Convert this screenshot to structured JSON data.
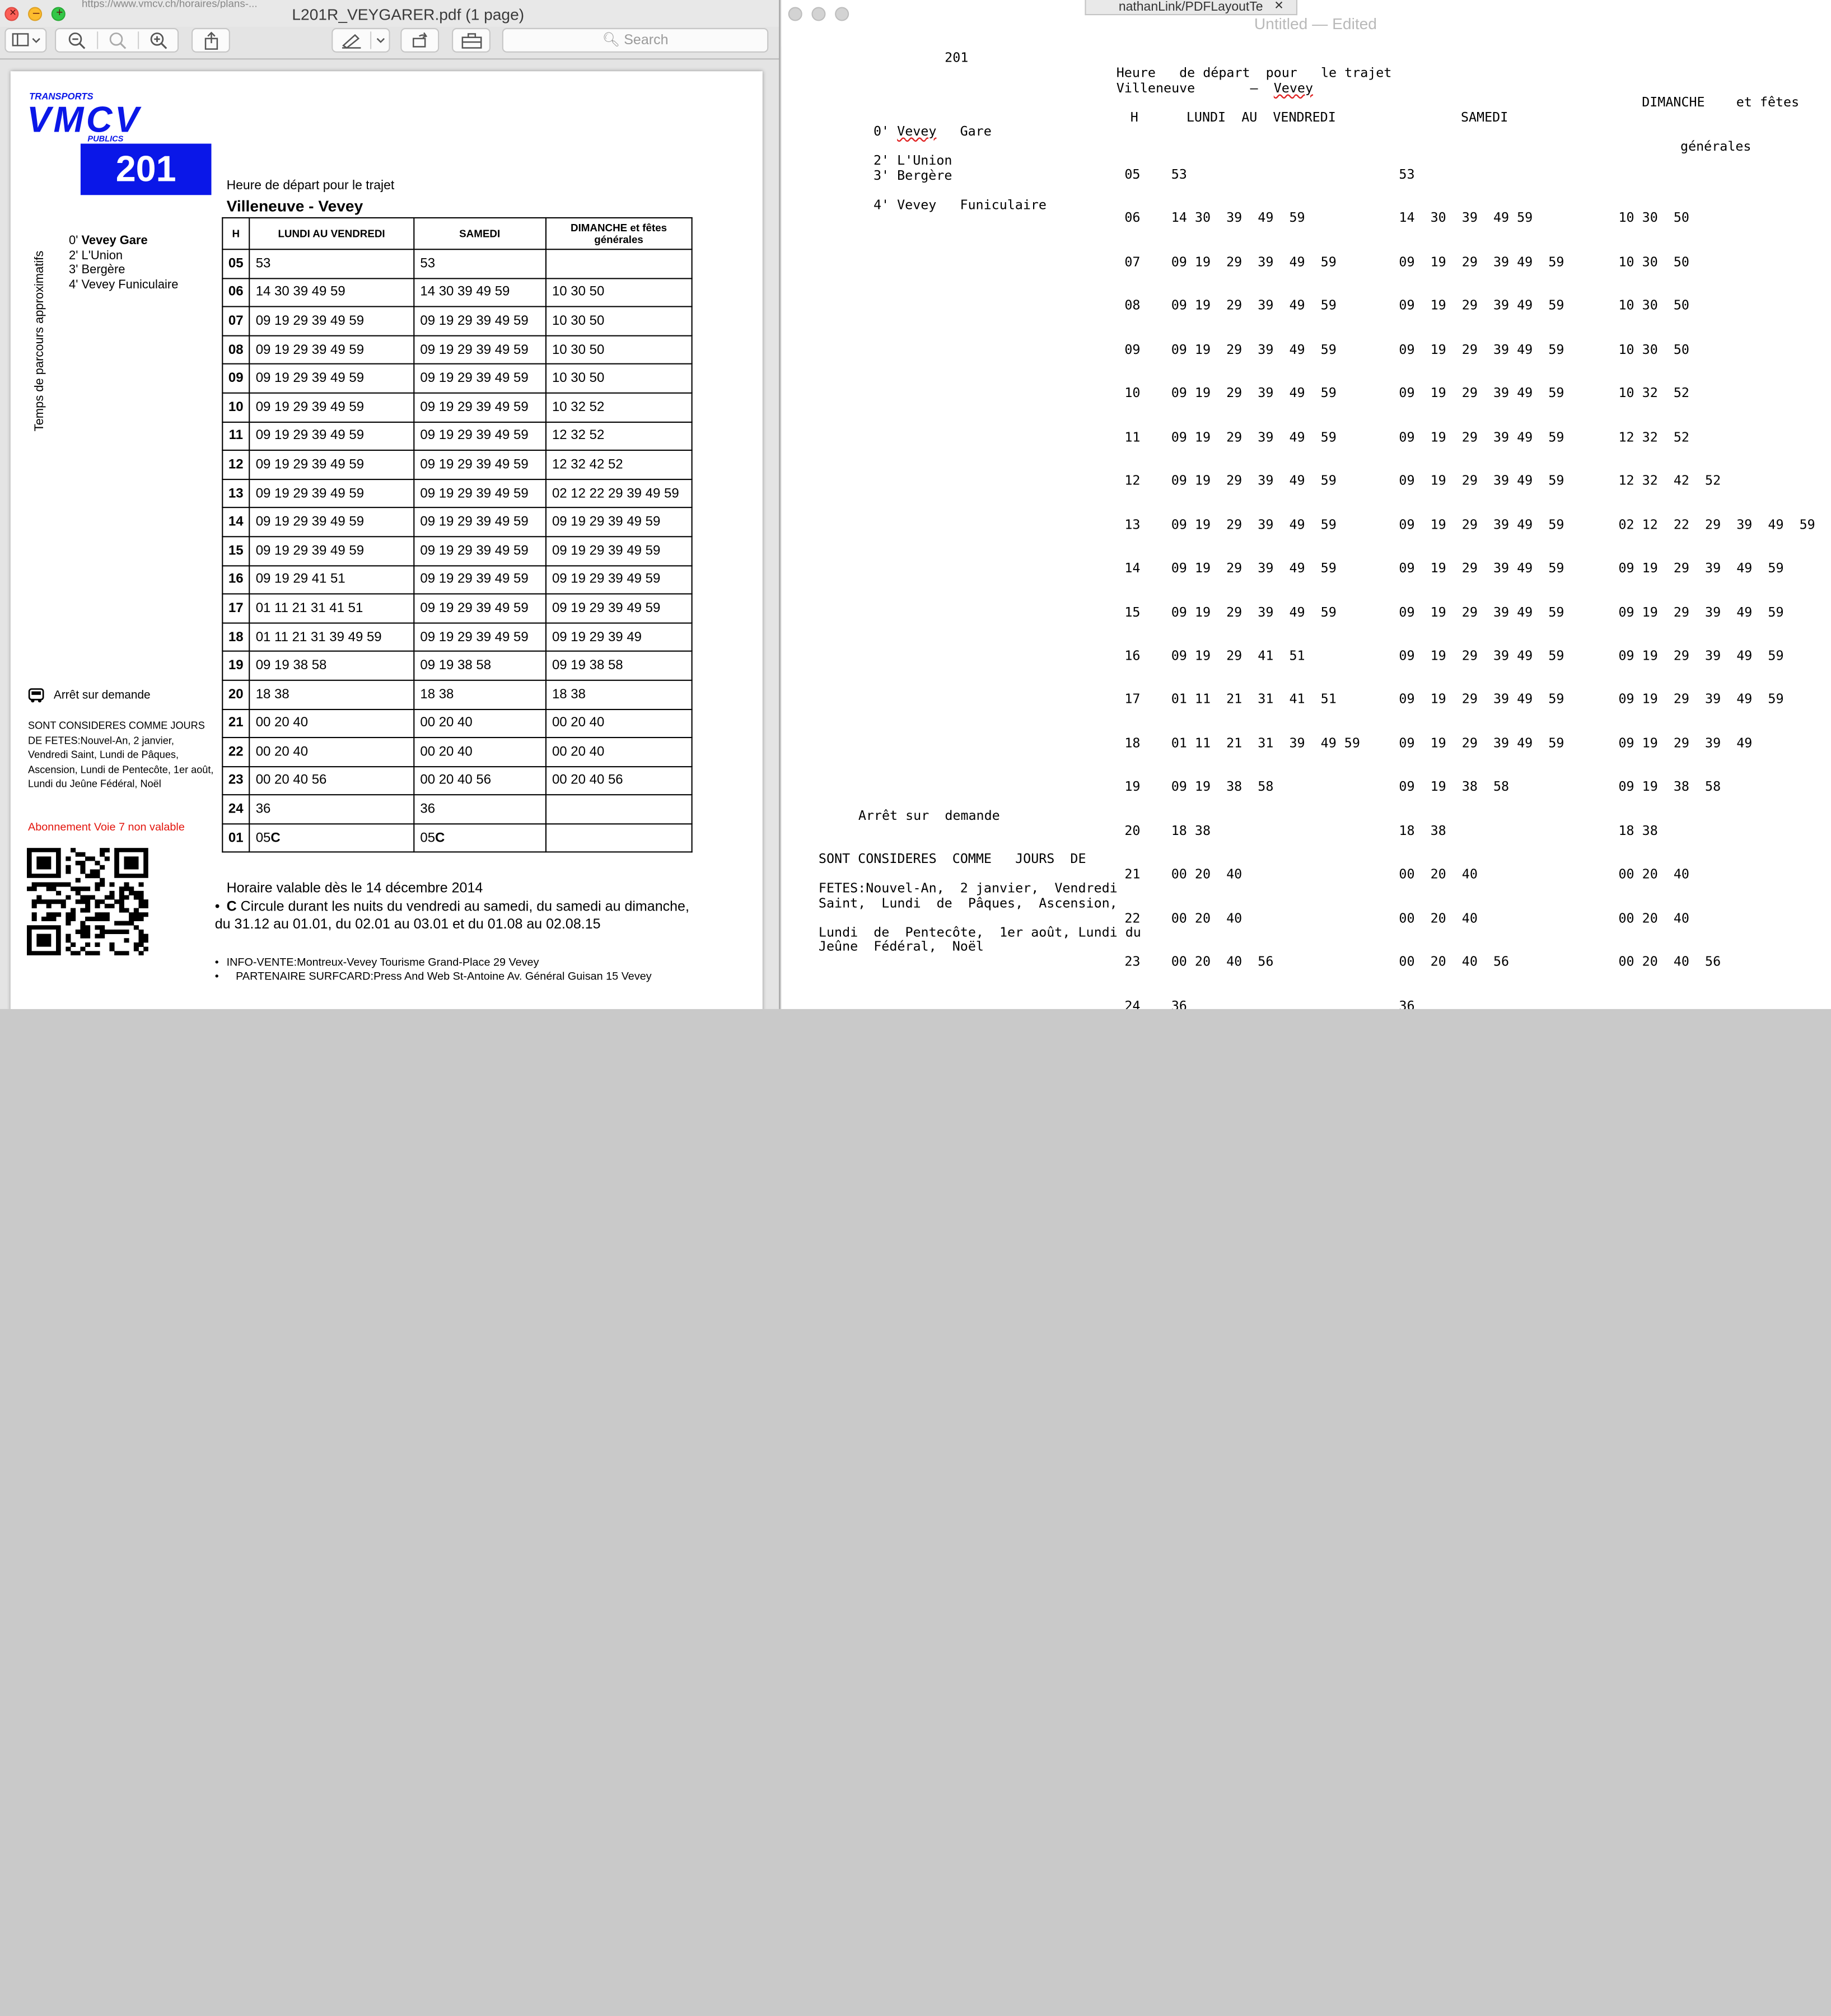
{
  "pdf_window": {
    "title": "L201R_VEYGARER.pdf (1 page)",
    "background_tab_text": "https://www.vmcv.ch/horaires/plans-...",
    "search_placeholder": "Search",
    "page": {
      "logo_top": "TRANSPORTS",
      "logo_main": "VMCV",
      "logo_bottom": "PUBLICS",
      "route_number": "201",
      "trip_heading": "Heure de départ pour le trajet",
      "trip_route": "Villeneuve - Vevey",
      "vertical_label": "Temps de parcours approximatifs",
      "stops": [
        {
          "time": "0'",
          "name": "Vevey Gare"
        },
        {
          "time": "2'",
          "name": "L'Union"
        },
        {
          "time": "3'",
          "name": "Bergère"
        },
        {
          "time": "4'",
          "name": "Vevey Funiculaire"
        }
      ],
      "table": {
        "headers": [
          "H",
          "LUNDI AU VENDREDI",
          "SAMEDI",
          "DIMANCHE et fêtes générales"
        ],
        "rows": [
          {
            "h": "05",
            "wk": "53",
            "sa": "53",
            "su": ""
          },
          {
            "h": "06",
            "wk": "14 30 39 49 59",
            "sa": "14 30 39 49 59",
            "su": "10 30 50"
          },
          {
            "h": "07",
            "wk": "09 19 29 39 49 59",
            "sa": "09 19 29 39 49 59",
            "su": "10 30 50"
          },
          {
            "h": "08",
            "wk": "09 19 29 39 49 59",
            "sa": "09 19 29 39 49 59",
            "su": "10 30 50"
          },
          {
            "h": "09",
            "wk": "09 19 29 39 49 59",
            "sa": "09 19 29 39 49 59",
            "su": "10 30 50"
          },
          {
            "h": "10",
            "wk": "09 19 29 39 49 59",
            "sa": "09 19 29 39 49 59",
            "su": "10 32 52"
          },
          {
            "h": "11",
            "wk": "09 19 29 39 49 59",
            "sa": "09 19 29 39 49 59",
            "su": "12 32 52"
          },
          {
            "h": "12",
            "wk": "09 19 29 39 49 59",
            "sa": "09 19 29 39 49 59",
            "su": "12 32 42 52"
          },
          {
            "h": "13",
            "wk": "09 19 29 39 49 59",
            "sa": "09 19 29 39 49 59",
            "su": "02 12 22 29 39 49 59"
          },
          {
            "h": "14",
            "wk": "09 19 29 39 49 59",
            "sa": "09 19 29 39 49 59",
            "su": "09 19 29 39 49 59"
          },
          {
            "h": "15",
            "wk": "09 19 29 39 49 59",
            "sa": "09 19 29 39 49 59",
            "su": "09 19 29 39 49 59"
          },
          {
            "h": "16",
            "wk": "09 19 29 41 51",
            "sa": "09 19 29 39 49 59",
            "su": "09 19 29 39 49 59"
          },
          {
            "h": "17",
            "wk": "01 11 21 31 41 51",
            "sa": "09 19 29 39 49 59",
            "su": "09 19 29 39 49 59"
          },
          {
            "h": "18",
            "wk": "01 11 21 31 39 49 59",
            "sa": "09 19 29 39 49 59",
            "su": "09 19 29 39 49"
          },
          {
            "h": "19",
            "wk": "09 19 38 58",
            "sa": "09 19 38 58",
            "su": "09 19 38 58"
          },
          {
            "h": "20",
            "wk": "18 38",
            "sa": "18 38",
            "su": "18 38"
          },
          {
            "h": "21",
            "wk": "00 20 40",
            "sa": "00 20 40",
            "su": "00 20 40"
          },
          {
            "h": "22",
            "wk": "00 20 40",
            "sa": "00 20 40",
            "su": "00 20 40"
          },
          {
            "h": "23",
            "wk": "00 20 40 56",
            "sa": "00 20 40 56",
            "su": "00 20 40 56"
          },
          {
            "h": "24",
            "wk": "36",
            "sa": "36",
            "su": ""
          },
          {
            "h": "01",
            "wk": "05",
            "wk_suffix": "C",
            "sa": "05",
            "sa_suffix": "C",
            "su": ""
          }
        ]
      },
      "stop_on_request": "Arrêt sur demande",
      "holidays_text": "SONT CONSIDERES COMME JOURS DE FETES:Nouvel-An, 2 janvier, Vendredi Saint, Lundi de Pâques, Ascension, Lundi de Pentecôte, 1er août, Lundi du Jeûne Fédéral, Noël",
      "abonnement": "Abonnement Voie 7 non valable",
      "validity": "Horaire valable dès le 14 décembre 2014",
      "note_c_letter": "C",
      "note_c_text": " Circule durant les nuits du vendredi au samedi, du samedi au dimanche, du 31.12 au 01.01, du 02.01 au 03.01 et du 01.08 au 02.08.15",
      "info_vente": "INFO-VENTE:Montreux-Vevey Tourisme Grand-Place 29 Vevey",
      "partenaire": "PARTENAIRE SURFCARD:Press And Web St-Antoine Av. Général Guisan 15 Vevey"
    }
  },
  "edit_window": {
    "title": "Untitled",
    "title_status": "— Edited",
    "tab_text": "nathanLink/PDFLayoutTe",
    "tab_close": "✕",
    "lines": {
      "route": "201",
      "heading": "Heure   de départ  pour   le trajet",
      "villeneuve": "Villeneuve",
      "dash": "–",
      "vevey": "Vevey",
      "dimanche": "DIMANCHE    et fêtes",
      "col_h": "H",
      "col_lundi": "LUNDI  AU  VENDREDI",
      "col_samedi": "SAMEDI",
      "generales": "générales",
      "stop0_time": "0'",
      "stop0_name": "Vevey",
      "stop0_gare": "Gare",
      "stop1": "2' L'Union",
      "stop2": "3' Bergère",
      "stop4": "4' Vevey   Funiculaire",
      "arret": "Arrêt sur  demande",
      "sont": "SONT CONSIDERES  COMME   JOURS  DE",
      "fetes": "FETES:Nouvel-An,  2 janvier,  Vendredi",
      "saint": "Saint,  Lundi  de  Pâques,  Ascension,",
      "lundi_pent": "Lundi  de  Pentecôte,  1er août, Lundi du",
      "jeune": "Jeûne  Fédéral,  Noël"
    },
    "rows": [
      {
        "h": "05",
        "wk": "53",
        "sa": "53",
        "su": ""
      },
      {
        "h": "06",
        "wk": "14 30  39  49  59",
        "sa": "14  30  39  49 59",
        "su": "10 30  50"
      },
      {
        "h": "07",
        "wk": "09 19  29  39  49  59",
        "sa": "09  19  29  39 49  59",
        "su": "10 30  50"
      },
      {
        "h": "08",
        "wk": "09 19  29  39  49  59",
        "sa": "09  19  29  39 49  59",
        "su": "10 30  50"
      },
      {
        "h": "09",
        "wk": "09 19  29  39  49  59",
        "sa": "09  19  29  39 49  59",
        "su": "10 30  50"
      },
      {
        "h": "10",
        "wk": "09 19  29  39  49  59",
        "sa": "09  19  29  39 49  59",
        "su": "10 32  52"
      },
      {
        "h": "11",
        "wk": "09 19  29  39  49  59",
        "sa": "09  19  29  39 49  59",
        "su": "12 32  52"
      },
      {
        "h": "12",
        "wk": "09 19  29  39  49  59",
        "sa": "09  19  29  39 49  59",
        "su": "12 32  42  52"
      },
      {
        "h": "13",
        "wk": "09 19  29  39  49  59",
        "sa": "09  19  29  39 49  59",
        "su": "02 12  22  29  39  49  59"
      },
      {
        "h": "14",
        "wk": "09 19  29  39  49  59",
        "sa": "09  19  29  39 49  59",
        "su": "09 19  29  39  49  59"
      },
      {
        "h": "15",
        "wk": "09 19  29  39  49  59",
        "sa": "09  19  29  39 49  59",
        "su": "09 19  29  39  49  59"
      },
      {
        "h": "16",
        "wk": "09 19  29  41  51",
        "sa": "09  19  29  39 49  59",
        "su": "09 19  29  39  49  59"
      },
      {
        "h": "17",
        "wk": "01 11  21  31  41  51",
        "sa": "09  19  29  39 49  59",
        "su": "09 19  29  39  49  59"
      },
      {
        "h": "18",
        "wk": "01 11  21  31  39  49 59",
        "sa": "09  19  29  39 49  59",
        "su": "09 19  29  39  49"
      },
      {
        "h": "19",
        "wk": "09 19  38  58",
        "sa": "09  19  38  58",
        "su": "09 19  38  58"
      },
      {
        "h": "20",
        "wk": "18 38",
        "sa": "18  38",
        "su": "18 38"
      },
      {
        "h": "21",
        "wk": "00 20  40",
        "sa": "00  20  40",
        "su": "00 20  40"
      },
      {
        "h": "22",
        "wk": "00 20  40",
        "sa": "00  20  40",
        "su": "00 20  40"
      },
      {
        "h": "23",
        "wk": "00 20  40  56",
        "sa": "00  20  40  56",
        "su": "00 20  40  56"
      },
      {
        "h": "24",
        "wk": "36",
        "sa": "36",
        "su": ""
      }
    ]
  },
  "colors": {
    "route_box": "#0a17e8",
    "abonnement_red": "#e3140c",
    "close_button": "#fc5f57",
    "minimize_button": "#fdbc2e",
    "zoom_button": "#33c748",
    "spell_underline": "#e02020"
  }
}
